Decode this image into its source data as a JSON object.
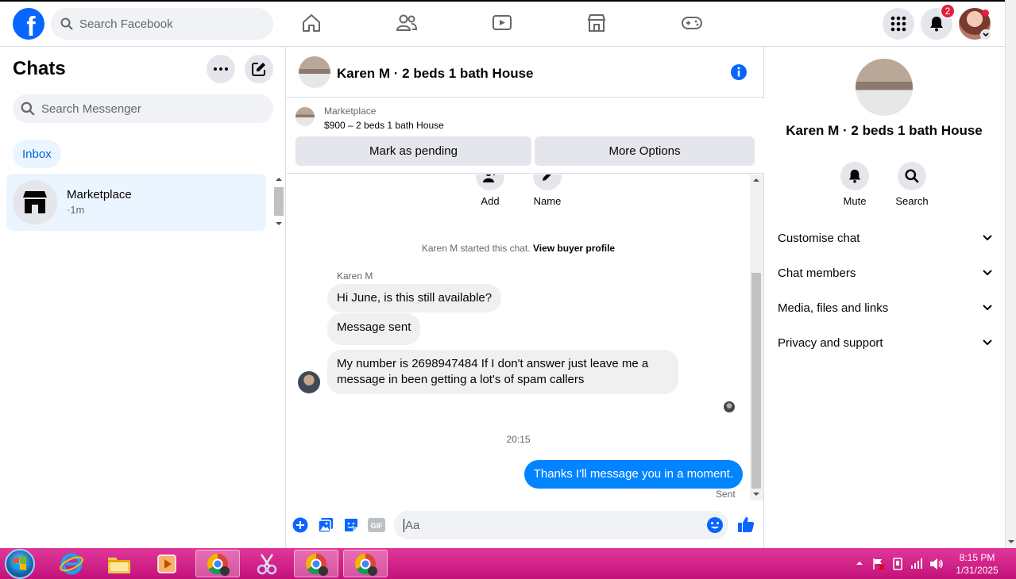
{
  "nav": {
    "search_placeholder": "Search Facebook",
    "notification_count": "2"
  },
  "chats": {
    "title": "Chats",
    "search_placeholder": "Search Messenger",
    "inbox_label": "Inbox",
    "items": [
      {
        "name": "Marketplace",
        "time": "·1m"
      }
    ]
  },
  "conversation": {
    "title": "Karen M · 2 beds 1 bath House",
    "marketplace_label": "Marketplace",
    "listing": "$900 – 2 beds 1 bath House",
    "mark_pending_label": "Mark as pending",
    "more_options_label": "More Options",
    "add_label": "Add",
    "name_label": "Name",
    "started_text": "Karen M started this chat.",
    "view_buyer_profile": "View buyer profile",
    "sender_name": "Karen M",
    "messages_in": [
      "Hi June, is this still available?",
      "Message sent",
      "My number is 2698947484 If I don't answer just leave me a message in been getting a lot's of spam callers"
    ],
    "timestamp": "20:15",
    "message_out": "Thanks I'll message you in a moment.",
    "sent_status": "Sent",
    "composer_placeholder": "Aa"
  },
  "details": {
    "title": "Karen M · 2 beds 1 bath House",
    "mute_label": "Mute",
    "search_label": "Search",
    "sections": [
      "Customise chat",
      "Chat members",
      "Media, files and links",
      "Privacy and support"
    ]
  },
  "taskbar": {
    "time": "8:15 PM",
    "date": "1/31/2025"
  },
  "colors": {
    "brand": "#0866ff",
    "messenger_blue": "#0084ff",
    "taskbar": "#d21f8a"
  }
}
